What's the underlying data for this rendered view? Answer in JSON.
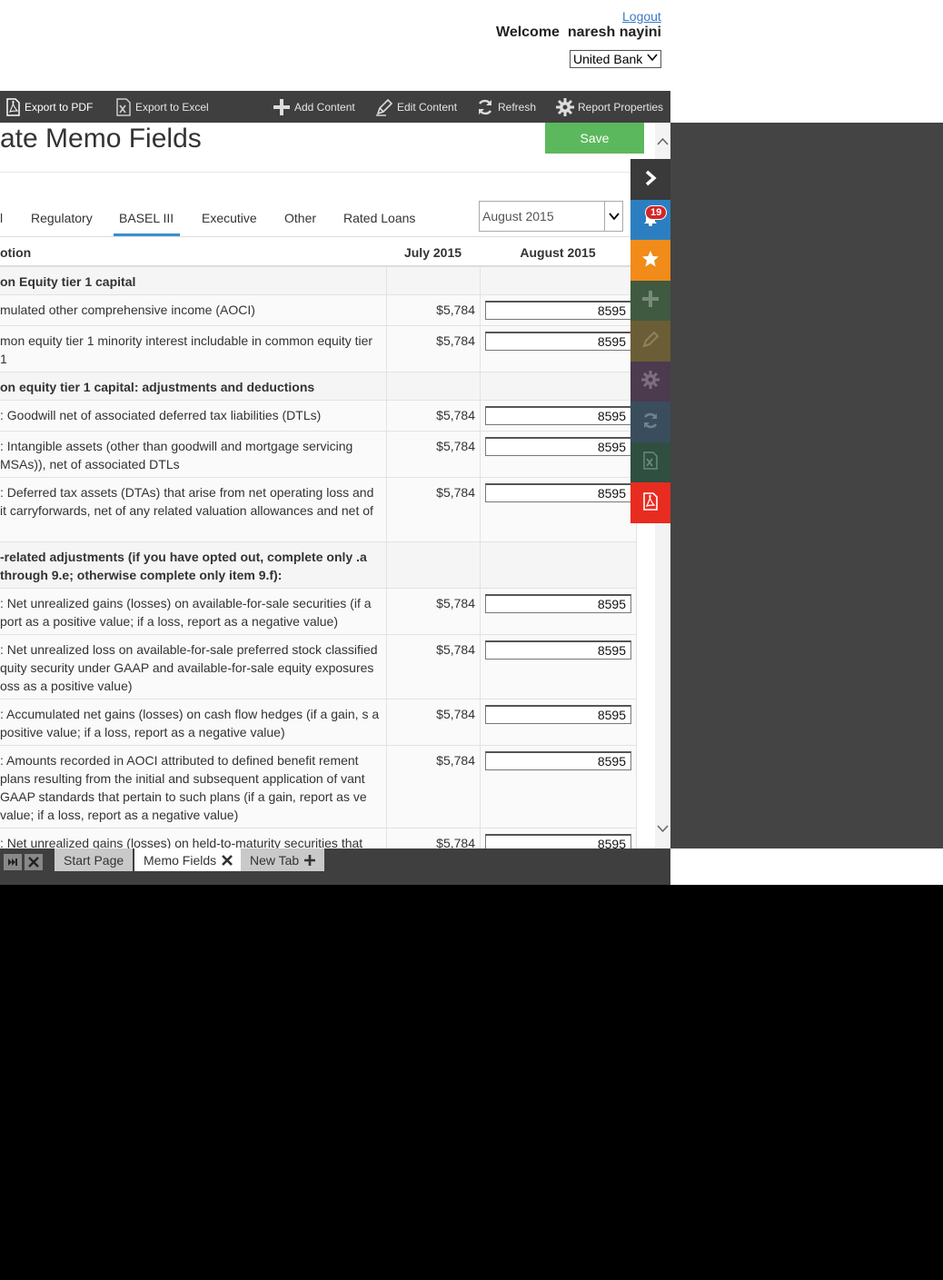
{
  "header": {
    "logout_label": "Logout",
    "welcome_label": "Welcome",
    "username": "naresh nayini",
    "bank_select_value": "United Bank"
  },
  "toolbar": {
    "items": [
      {
        "label": "Export to PDF",
        "icon": "pdf-icon"
      },
      {
        "label": "Export to Excel",
        "icon": "excel-icon"
      },
      {
        "label": "Add Content",
        "icon": "plus-icon"
      },
      {
        "label": "Edit Content",
        "icon": "pencil-icon"
      },
      {
        "label": "Refresh",
        "icon": "refresh-icon"
      },
      {
        "label": "Report Properties",
        "icon": "gear-icon"
      }
    ]
  },
  "page": {
    "title": "ate Memo Fields",
    "save_label": "Save"
  },
  "tabs": [
    {
      "label": "l"
    },
    {
      "label": "Regulatory"
    },
    {
      "label": "BASEL III",
      "active": true
    },
    {
      "label": "Executive"
    },
    {
      "label": "Other"
    },
    {
      "label": "Rated Loans"
    }
  ],
  "month_select_value": "August 2015",
  "table": {
    "headers": {
      "description": "otion",
      "july": "July 2015",
      "august": "August 2015"
    },
    "rows": [
      {
        "type": "section",
        "desc": "on Equity tier 1 capital"
      },
      {
        "type": "item",
        "desc": "mulated other comprehensive income (AOCI)",
        "july": "$5,784",
        "aug": "8595"
      },
      {
        "type": "item",
        "desc": "mon equity tier 1 minority interest includable in common equity tier 1",
        "july": "$5,784",
        "aug": "8595"
      },
      {
        "type": "section",
        "desc": "on equity tier 1 capital: adjustments and deductions"
      },
      {
        "type": "item",
        "desc": ": Goodwill net of associated deferred tax liabilities (DTLs)",
        "july": "$5,784",
        "aug": "8595"
      },
      {
        "type": "item",
        "desc": ": Intangible assets (other than goodwill and mortgage servicing MSAs)), net of associated DTLs",
        "july": "$5,784",
        "aug": "8595"
      },
      {
        "type": "item",
        "desc": ": Deferred tax assets (DTAs) that arise from net operating loss and it carryforwards, net of any related valuation allowances and net of",
        "july": "$5,784",
        "aug": "8595"
      },
      {
        "type": "section",
        "desc": "-related adjustments (if you have opted out, complete only .a through 9.e; otherwise complete only item 9.f):"
      },
      {
        "type": "item",
        "desc": ": Net unrealized gains (losses) on available-for-sale securities (if a port as a positive value; if a loss, report as a negative value)",
        "july": "$5,784",
        "aug": "8595"
      },
      {
        "type": "item",
        "desc": ": Net unrealized loss on available-for-sale preferred stock classified quity security under GAAP and available-for-sale equity exposures oss as a positive value)",
        "july": "$5,784",
        "aug": "8595"
      },
      {
        "type": "item",
        "desc": ": Accumulated net gains (losses) on cash flow hedges (if a gain, s a positive value; if a loss, report as a negative value)",
        "july": "$5,784",
        "aug": "8595"
      },
      {
        "type": "item",
        "desc": ": Amounts recorded in AOCI attributed to defined benefit rement plans resulting from the initial and subsequent application of vant GAAP standards that pertain to such plans (if a gain, report as ve value; if a loss, report as a negative value)",
        "july": "$5,784",
        "aug": "8595"
      },
      {
        "type": "item",
        "desc": ": Net unrealized gains (losses) on held-to-maturity securities that",
        "july": "$5,784",
        "aug": "8595"
      }
    ]
  },
  "side_panel": {
    "notification_count": "19",
    "buttons": [
      {
        "icon": "chevron-right-icon",
        "color": "#3a3a3a"
      },
      {
        "icon": "bell-icon",
        "color": "#2b7fc1"
      },
      {
        "icon": "star-icon",
        "color": "#f18b1a"
      },
      {
        "icon": "plus-icon",
        "color": "#3f5a40"
      },
      {
        "icon": "pencil-icon",
        "color": "#6b5d35"
      },
      {
        "icon": "gear-icon",
        "color": "#4c3a4e"
      },
      {
        "icon": "refresh-icon",
        "color": "#3a4d5d"
      },
      {
        "icon": "excel-icon",
        "color": "#2f4f40"
      },
      {
        "icon": "pdf-icon",
        "color": "#e82c1f"
      }
    ]
  },
  "bottom_tabs": [
    {
      "label": "Start Page"
    },
    {
      "label": "Memo Fields",
      "active": true
    },
    {
      "label": "New Tab"
    }
  ]
}
